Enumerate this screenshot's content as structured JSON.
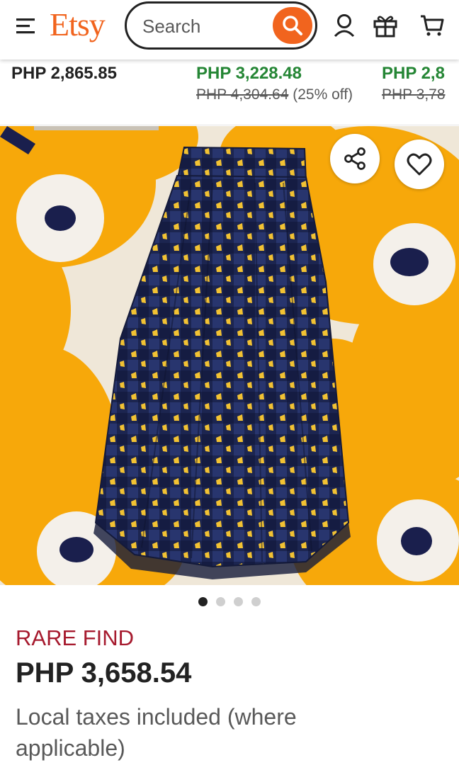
{
  "header": {
    "logo": "Etsy",
    "search_placeholder": "Search",
    "icons": [
      "menu-icon",
      "search-icon",
      "account-icon",
      "gift-icon",
      "cart-icon"
    ]
  },
  "related": [
    {
      "price": "PHP 2,865.85",
      "original": "",
      "discount": "",
      "color": "#222222"
    },
    {
      "price": "PHP 3,228.48",
      "original": "PHP 4,304.64",
      "discount": "(25% off)",
      "color": "#258635"
    },
    {
      "price": "PHP 2,8",
      "original": "PHP 3,78",
      "discount": "",
      "color": "#258635"
    }
  ],
  "listing": {
    "badge": "RARE FIND",
    "price": "PHP 3,658.54",
    "tax_note": "Local taxes included (where applicable)",
    "carousel": {
      "count": 4,
      "active": 1
    }
  },
  "colors": {
    "brand": "#F1641E",
    "badge": "#A61A2E",
    "sale": "#258635",
    "skirt_navy": "#1c2550",
    "flower_yellow": "#F7A80A"
  }
}
